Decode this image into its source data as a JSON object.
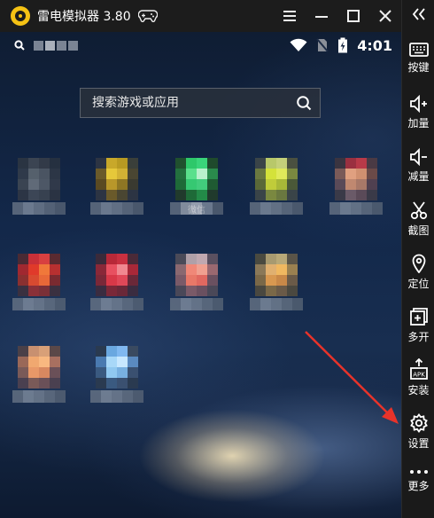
{
  "window": {
    "title": "雷电模拟器 3.80",
    "icons": [
      "ldplayer-logo-icon",
      "gamepad-icon",
      "menu-icon",
      "minimize-icon",
      "maximize-icon",
      "close-icon"
    ]
  },
  "status_bar": {
    "time": "4:01",
    "icons": [
      "search-icon",
      "wifi-icon",
      "no-sim-icon",
      "battery-charging-icon"
    ]
  },
  "search": {
    "placeholder": "搜索游戏或应用"
  },
  "apps": [
    {
      "name": "",
      "colors": [
        "#2a3442",
        "#3b4452",
        "#323a48",
        "#253040",
        "#2f3a4a",
        "#55606c",
        "#4a5462",
        "#2c3646",
        "#3a4452",
        "#606a78",
        "#4d5766",
        "#30394a",
        "#2c3545",
        "#3c4656",
        "#374150",
        "#2a3343"
      ],
      "label_colors": [
        "#6e7a8a",
        "#8a95a5",
        "#7a8595",
        "#6a7686",
        "#5c6878"
      ]
    },
    {
      "name": "",
      "colors": [
        "#2c3443",
        "#c8a82a",
        "#b89a22",
        "#3a3f3a",
        "#6a5a2a",
        "#e6c83a",
        "#d2b234",
        "#4a4632",
        "#5a4a22",
        "#b8972a",
        "#8e7624",
        "#3a3a30",
        "#2c3443",
        "#6a5a2a",
        "#4a4632",
        "#2c3443"
      ],
      "label_colors": [
        "#6c7888",
        "#8894a4",
        "#7c8898",
        "#6c7888",
        "#5c6878"
      ]
    },
    {
      "name": "微信",
      "colors": [
        "#20502e",
        "#2ec86a",
        "#3ad47a",
        "#1f4a2c",
        "#23703e",
        "#5ae08c",
        "#b8f0cc",
        "#2a8a4c",
        "#1e6a38",
        "#36c872",
        "#42cc7c",
        "#1f5a32",
        "#213a2c",
        "#1e6a38",
        "#238a48",
        "#203a2c"
      ],
      "label_colors": [
        "#6c7888",
        "#a5adb8",
        "#c0c6cf",
        "#8894a4",
        "#5c6878"
      ]
    },
    {
      "name": "",
      "colors": [
        "#3a4448",
        "#b8c86a",
        "#c4d07a",
        "#4a5040",
        "#6a7840",
        "#d4e23a",
        "#e0ea5a",
        "#7a8840",
        "#5a6838",
        "#c0cc3a",
        "#a8b838",
        "#4a5838",
        "#3a4448",
        "#7a8840",
        "#6a7840",
        "#3a4448"
      ],
      "label_colors": [
        "#6c7888",
        "#8894a4",
        "#7c8898",
        "#6c7888",
        "#5c6878"
      ]
    },
    {
      "name": "",
      "colors": [
        "#3a3440",
        "#9a3040",
        "#b83a48",
        "#4a3a44",
        "#7a5a58",
        "#e0a080",
        "#d09070",
        "#6a4a48",
        "#5a4a58",
        "#c08870",
        "#a87868",
        "#504050",
        "#3a3a48",
        "#6a5a68",
        "#5a4a58",
        "#3a3a48"
      ],
      "label_colors": [
        "#6c7888",
        "#8894a4",
        "#7c8898",
        "#6c7888",
        "#5c6878"
      ]
    },
    {
      "name": "",
      "colors": [
        "#4a2a34",
        "#c83038",
        "#d84040",
        "#5a2a30",
        "#a02830",
        "#e03a2a",
        "#f0783a",
        "#b83030",
        "#8a3030",
        "#d84a30",
        "#e86838",
        "#7a2a30",
        "#3a3040",
        "#8a3038",
        "#7a3038",
        "#3a3040"
      ],
      "label_colors": [
        "#6c7888",
        "#8894a4",
        "#7c8898",
        "#6c7888",
        "#5c6878"
      ]
    },
    {
      "name": "",
      "colors": [
        "#3a2a3a",
        "#b82838",
        "#c83040",
        "#4a2a38",
        "#8a2838",
        "#e85060",
        "#f08890",
        "#a82838",
        "#7a2838",
        "#d83848",
        "#e04858",
        "#6a2838",
        "#3a2c40",
        "#7a2838",
        "#6a2838",
        "#3a2c40"
      ],
      "label_colors": [
        "#6c7888",
        "#8894a4",
        "#7c8898",
        "#6c7888",
        "#5c6878"
      ]
    },
    {
      "name": "",
      "colors": [
        "#4a4a58",
        "#b0a0a8",
        "#c0a8b0",
        "#5a5060",
        "#8a6870",
        "#f08878",
        "#f0a090",
        "#9a6870",
        "#7a5a68",
        "#e87868",
        "#e06860",
        "#6a5060",
        "#4a4858",
        "#7a5a68",
        "#6a5060",
        "#4a4858"
      ],
      "label_colors": [
        "#6c7888",
        "#8894a4",
        "#7c8898",
        "#6c7888",
        "#5c6878"
      ]
    },
    {
      "name": "",
      "colors": [
        "#4a4a40",
        "#a89a70",
        "#b8a878",
        "#5a5448",
        "#8a7858",
        "#e0b070",
        "#f0b860",
        "#9a8050",
        "#7a6848",
        "#d89850",
        "#c88848",
        "#6a5a48",
        "#4a4840",
        "#7a6848",
        "#6a5a48",
        "#4a4840"
      ],
      "label_colors": [
        "#6c7888",
        "#8894a4",
        "#7c8898",
        "#6c7888",
        "#5c6878"
      ]
    },
    {
      "name": "",
      "colors": [
        "#4a4048",
        "#c89070",
        "#d8a078",
        "#5a4848",
        "#9a6858",
        "#f0a870",
        "#f8b880",
        "#a87060",
        "#7a5a58",
        "#e89868",
        "#d88860",
        "#6a5058",
        "#4a4050",
        "#7a5a58",
        "#6a5058",
        "#4a4050"
      ],
      "label_colors": [
        "#6c7888",
        "#8894a4",
        "#7c8898",
        "#6c7888",
        "#5c6878"
      ]
    },
    {
      "name": "",
      "colors": [
        "#2a3a50",
        "#6aa8e0",
        "#80b8f0",
        "#3a4a60",
        "#4a7ab0",
        "#a8d8f8",
        "#c8e8ff",
        "#5a8ac0",
        "#3a5a80",
        "#90c8f0",
        "#78b0e0",
        "#3a5070",
        "#2a3a50",
        "#3a5a80",
        "#3a5070",
        "#2a3a50"
      ],
      "label_colors": [
        "#6c7888",
        "#8894a4",
        "#7c8898",
        "#6c7888",
        "#5c6878"
      ]
    }
  ],
  "sidebar": {
    "items": [
      {
        "label": "按键",
        "icon": "keyboard-icon"
      },
      {
        "label": "加量",
        "icon": "volume-up-icon"
      },
      {
        "label": "减量",
        "icon": "volume-down-icon"
      },
      {
        "label": "截图",
        "icon": "scissors-icon"
      },
      {
        "label": "定位",
        "icon": "location-pin-icon"
      },
      {
        "label": "多开",
        "icon": "multi-instance-icon"
      },
      {
        "label": "安装",
        "icon": "apk-install-icon"
      },
      {
        "label": "设置",
        "icon": "gear-icon"
      },
      {
        "label": "更多",
        "icon": "more-dots-icon"
      }
    ],
    "collapse_icon": "double-chevron-left-icon"
  },
  "annotation": {
    "color": "#e8332a"
  }
}
